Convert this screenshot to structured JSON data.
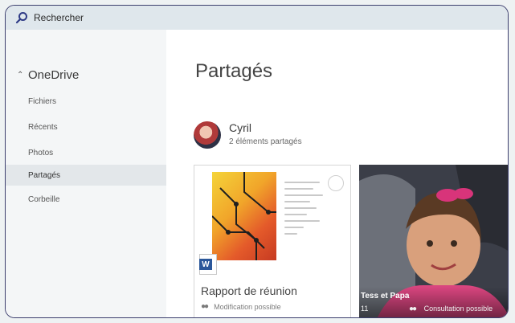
{
  "topbar": {
    "search_label": "Rechercher"
  },
  "sidebar": {
    "root_label": "OneDrive",
    "items": [
      {
        "label": "Fichiers",
        "active": false
      },
      {
        "label": "Récents",
        "active": false
      },
      {
        "label": "Photos",
        "active": false
      },
      {
        "label": "Partagés",
        "active": true
      },
      {
        "label": "Corbeille",
        "active": false
      }
    ]
  },
  "main": {
    "title": "Partagés",
    "owner": {
      "name": "Cyril",
      "count_text": "2 éléments partagés"
    },
    "cards": [
      {
        "title": "Rapport de réunion",
        "subtitle": "Modification possible",
        "type": "word"
      },
      {
        "title": "Tess et Papa",
        "count": "11",
        "subtitle": "Consultation possible",
        "type": "album"
      }
    ]
  },
  "colors": {
    "accent": "#2b579a",
    "sidebar_active": "#e3e7ea",
    "frame_border": "#3c3f6e"
  }
}
